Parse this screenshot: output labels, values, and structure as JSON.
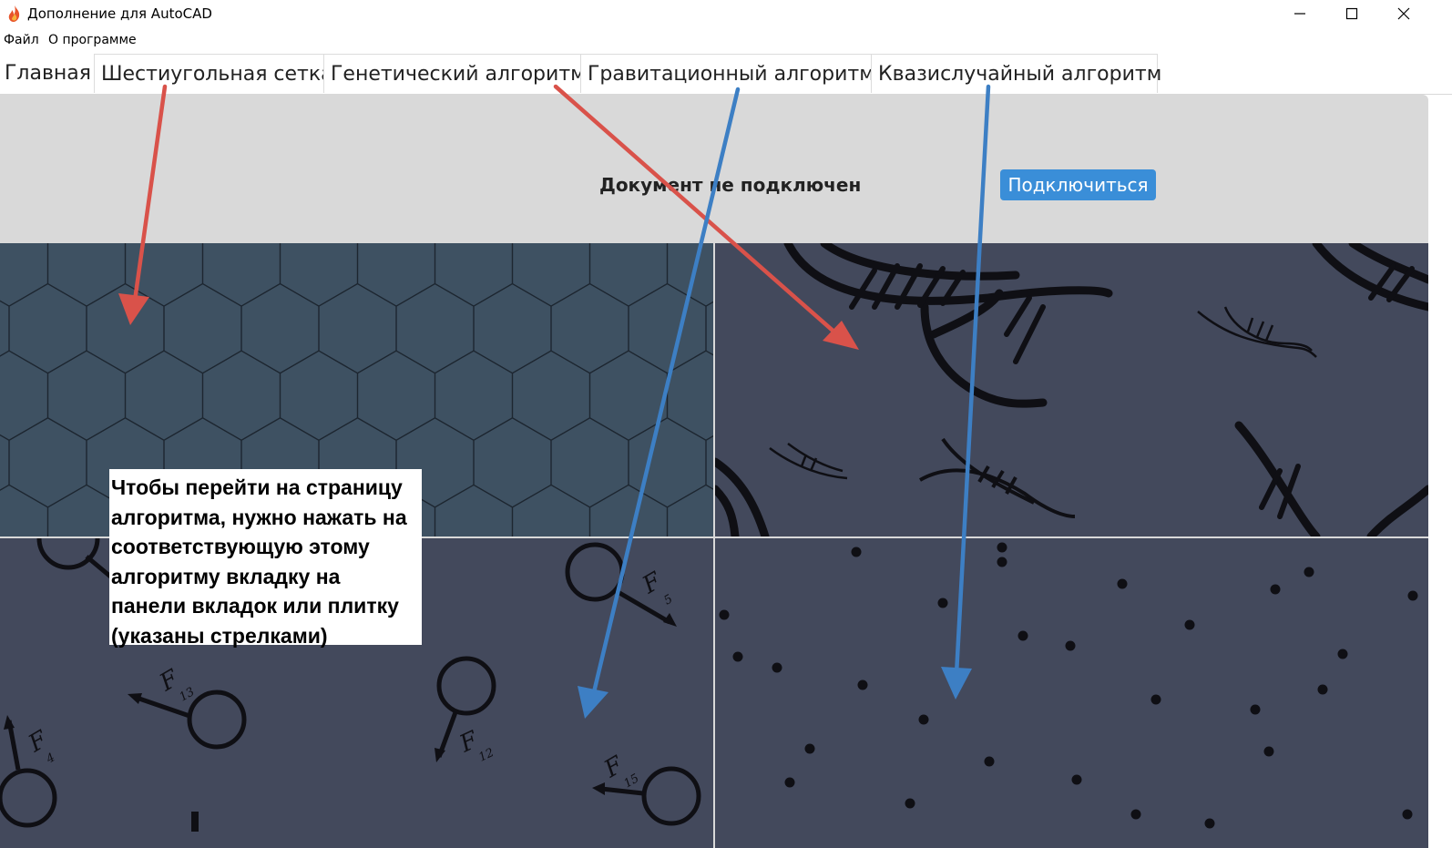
{
  "window": {
    "title": "Дополнение для AutoCAD",
    "app_icon": "flame-icon",
    "controls": [
      "minimize-icon",
      "maximize-icon",
      "close-icon"
    ]
  },
  "menu": {
    "items": [
      {
        "label": "Файл"
      },
      {
        "label": "О программе"
      }
    ]
  },
  "tabs": [
    {
      "label": "Главная",
      "active": true
    },
    {
      "label": "Шестиугольная сетка"
    },
    {
      "label": "Генетический алгоритм"
    },
    {
      "label": "Гравитационный алгоритм"
    },
    {
      "label": "Квазислучайный алгоритм"
    }
  ],
  "header": {
    "status_text": "Документ не подключен",
    "connect_label": "Подключиться"
  },
  "tiles": [
    {
      "name": "hexagonal-grid",
      "bg": "#3e5162"
    },
    {
      "name": "genetic",
      "bg": "#43495c"
    },
    {
      "name": "gravitational",
      "bg": "#43495c",
      "force_labels": [
        "F",
        "5",
        "F",
        "13",
        "F",
        "4",
        "F",
        "12",
        "F",
        "15"
      ]
    },
    {
      "name": "quasirandom",
      "bg": "#43495c"
    }
  ],
  "annotation": {
    "text": "Чтобы перейти на страницу алгоритма, нужно нажать на соответствующую этому алгоритму вкладку на панели вкладок или плитку (указаны стрелками)"
  },
  "colors": {
    "accent": "#3a8ed8",
    "arrow_red": "#d9524a",
    "arrow_blue": "#3d7fc4",
    "panel_bg": "#d9d9d9"
  }
}
